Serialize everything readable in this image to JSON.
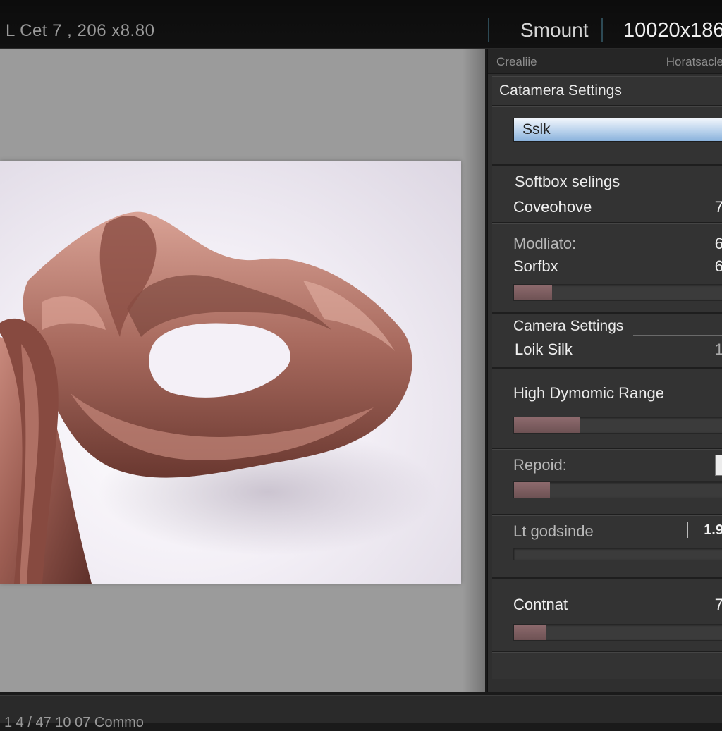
{
  "topbar": {
    "coords": "L Cet 7 , 206 x8.80",
    "mode": "Smount",
    "dimensions": "10020x186"
  },
  "panel": {
    "header_left": "Crealiie",
    "header_right": "Horatsacle",
    "camera_settings_title": "Catamera Settings",
    "preset_input_value": "Sslk",
    "softbox_title": "Softbox selings",
    "coveohove_label": "Coveohove",
    "coveohove_value": "7",
    "modliato_label": "Modliato:",
    "modliato_value": "6",
    "sorfbx_label": "Sorfbx",
    "sorfbx_value": "6",
    "sorfbx_slider": 0.18,
    "camera_settings2_title": "Camera Settings",
    "loik_label": "Loik Silk",
    "loik_value": "1",
    "hdr_title": "High Dymomic Range",
    "hdr_slider": 0.31,
    "repoid_label": "Repoid:",
    "repoid_slider": 0.17,
    "lt_label": "Lt godsinde",
    "lt_value": "1.9",
    "lt_slider": 0,
    "contrast_label": "Contnat",
    "contrast_value": "7",
    "contrast_slider": 0.15
  },
  "status": {
    "text": "1 4 / 47 10 07 Commo"
  },
  "colors": {
    "accent_input": "#8ab2dc",
    "slider_fill": "#7a5c5f",
    "silk": "#a8685c"
  }
}
